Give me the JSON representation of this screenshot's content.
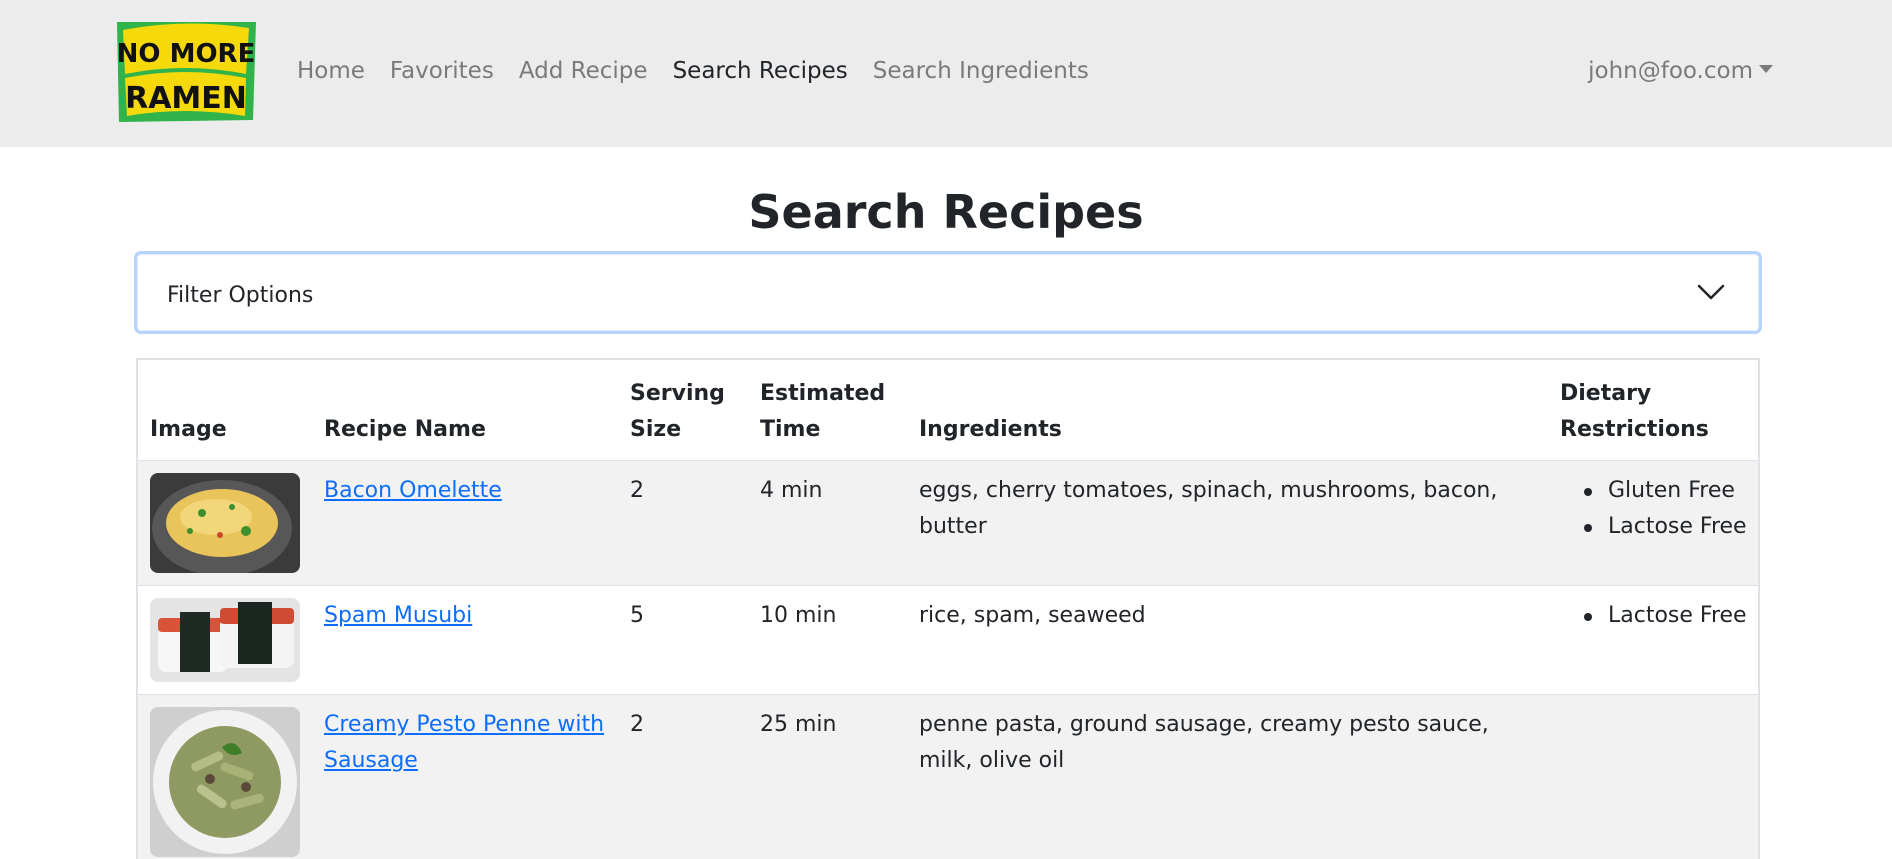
{
  "navbar": {
    "logo_text": [
      "NO MORE",
      "RAMEN"
    ],
    "links": [
      {
        "label": "Home",
        "active": false
      },
      {
        "label": "Favorites",
        "active": false
      },
      {
        "label": "Add Recipe",
        "active": false
      },
      {
        "label": "Search Recipes",
        "active": true
      },
      {
        "label": "Search Ingredients",
        "active": false
      }
    ],
    "user": "john@foo.com"
  },
  "page": {
    "title": "Search Recipes"
  },
  "filter": {
    "label": "Filter Options",
    "icon": "chevron-down-icon"
  },
  "table": {
    "headers": {
      "image": "Image",
      "name": "Recipe Name",
      "serving": "Serving Size",
      "time": "Estimated Time",
      "ingredients": "Ingredients",
      "dietary": "Dietary Restrictions"
    },
    "rows": [
      {
        "image": "bacon-omelette-photo",
        "name": "Bacon Omelette",
        "serving": "2",
        "time": "4 min",
        "ingredients": "eggs, cherry tomatoes, spinach, mushrooms, bacon, butter",
        "dietary": [
          "Gluten Free",
          "Lactose Free"
        ]
      },
      {
        "image": "spam-musubi-photo",
        "name": "Spam Musubi",
        "serving": "5",
        "time": "10 min",
        "ingredients": "rice, spam, seaweed",
        "dietary": [
          "Lactose Free"
        ]
      },
      {
        "image": "creamy-pesto-penne-photo",
        "name": "Creamy Pesto Penne with Sausage",
        "serving": "2",
        "time": "25 min",
        "ingredients": "penne pasta, ground sausage, creamy pesto sauce, milk, olive oil",
        "dietary": []
      }
    ]
  },
  "colors": {
    "navbar_bg": "#ececec",
    "link": "#0d6efd",
    "filter_border": "#b6d3fb",
    "logo_green": "#2fb34a",
    "logo_yellow": "#f5d90a"
  }
}
